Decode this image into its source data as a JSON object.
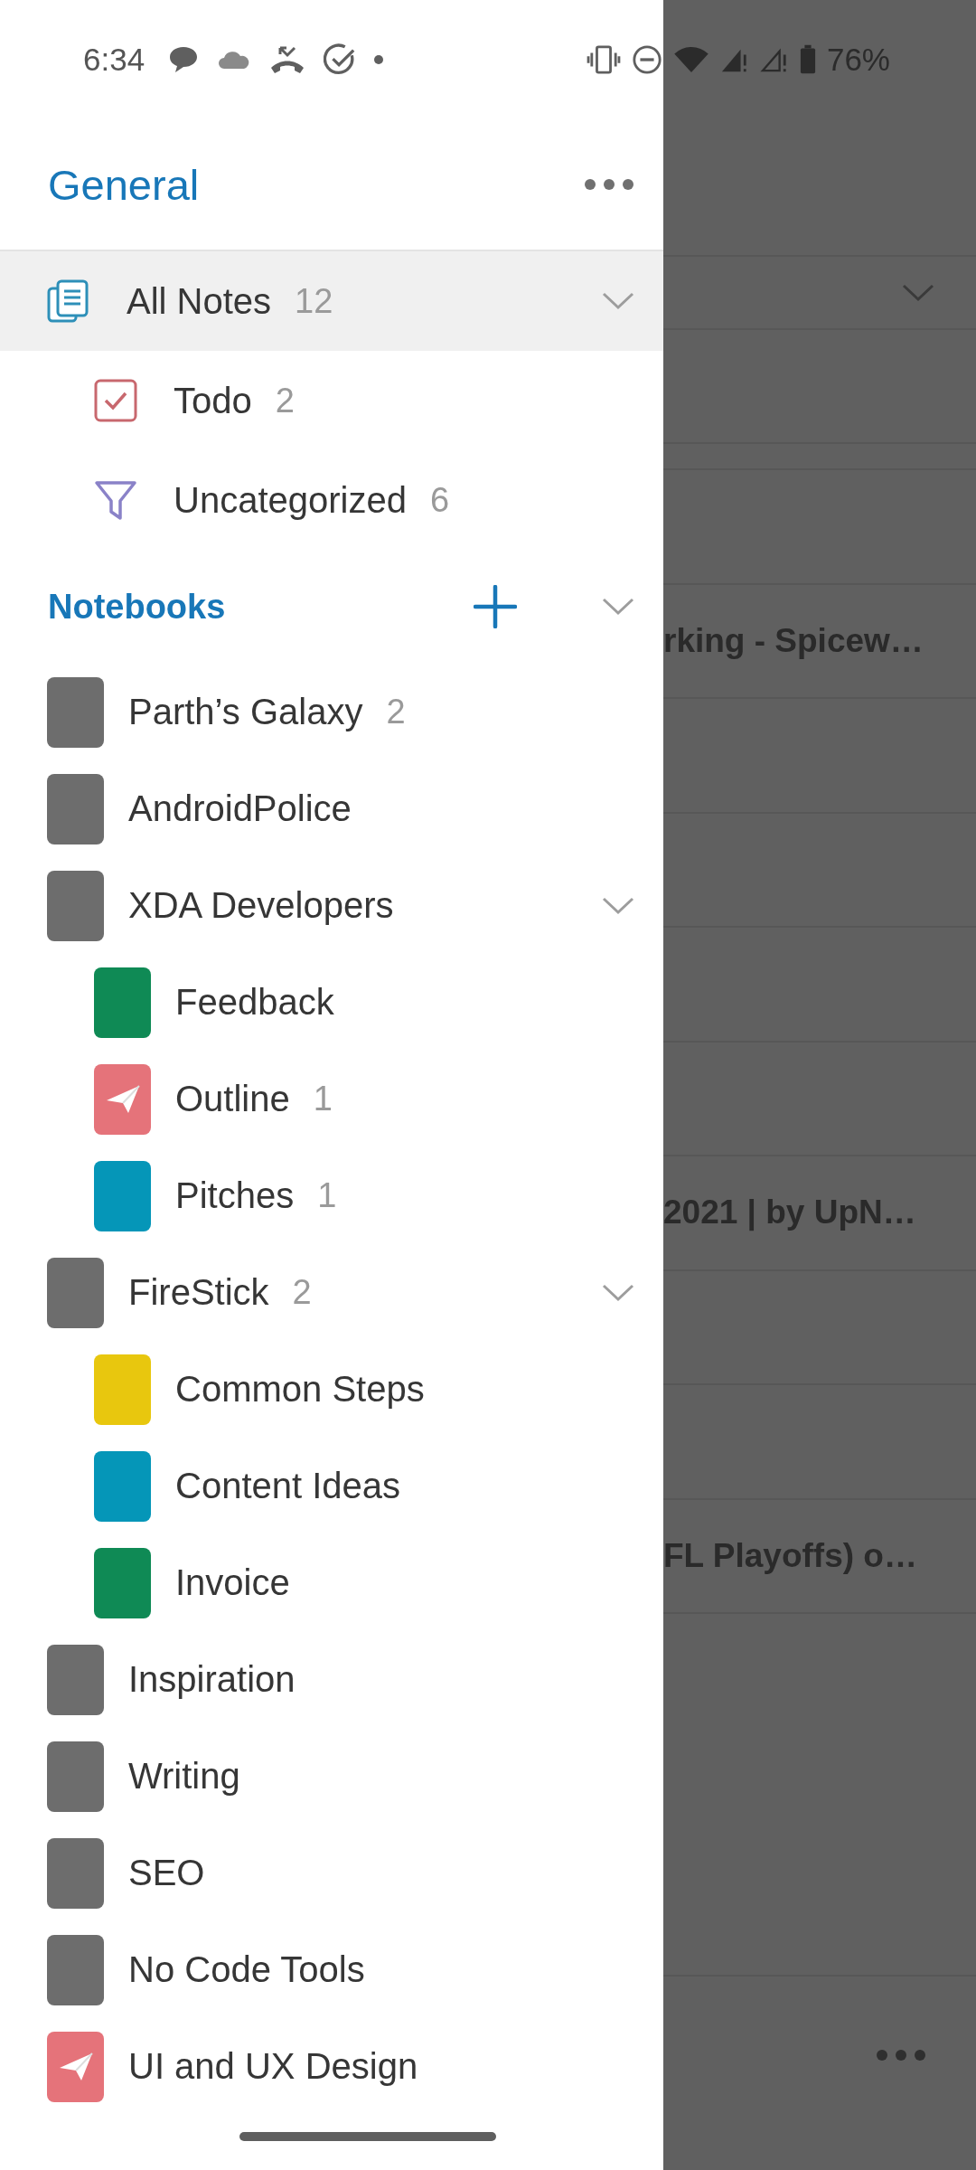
{
  "status_bar": {
    "time": "6:34",
    "battery": "76%"
  },
  "drawer": {
    "title": "General",
    "library": [
      {
        "kind": "all",
        "label": "All Notes",
        "count": "12",
        "selected": true
      },
      {
        "kind": "todo",
        "label": "Todo",
        "count": "2",
        "selected": false
      },
      {
        "kind": "uncategorized",
        "label": "Uncategorized",
        "count": "6",
        "selected": false
      }
    ],
    "notebooks_title": "Notebooks",
    "notebooks": [
      {
        "kind": "photo",
        "label": "Parth’s Galaxy",
        "count": "2",
        "selected": false
      },
      {
        "kind": "photo",
        "label": "AndroidPolice",
        "selected": false
      },
      {
        "kind": "photo",
        "label": "XDA Developers",
        "selected": false,
        "expanded": true,
        "children": [
          {
            "kind": "tile",
            "label": "Feedback",
            "color": "#0f8a55",
            "selected": false
          },
          {
            "kind": "plane",
            "label": "Outline",
            "count": "1",
            "color": "#e5737a",
            "selected": false
          },
          {
            "kind": "tile",
            "label": "Pitches",
            "count": "1",
            "color": "#0596b8",
            "selected": false
          }
        ]
      },
      {
        "kind": "photo",
        "label": "FireStick",
        "count": "2",
        "selected": false,
        "expanded": true,
        "children": [
          {
            "kind": "tile",
            "label": "Common Steps",
            "color": "#e8c70e",
            "selected": false
          },
          {
            "kind": "tile",
            "label": "Content Ideas",
            "color": "#0596b8",
            "selected": false
          },
          {
            "kind": "tile",
            "label": "Invoice",
            "color": "#0f8a55",
            "selected": false
          }
        ]
      },
      {
        "kind": "photo",
        "label": "Inspiration",
        "selected": false
      },
      {
        "kind": "photo",
        "label": "Writing",
        "selected": false
      },
      {
        "kind": "photo",
        "label": "SEO",
        "selected": false
      },
      {
        "kind": "photo",
        "label": "No Code Tools",
        "selected": false
      },
      {
        "kind": "plane",
        "label": "UI and UX Design",
        "color": "#e5737a",
        "selected": false
      }
    ]
  },
  "background_list": {
    "rows": [
      {},
      {
        "title": "rking - Spicew…"
      },
      {},
      {},
      {},
      {},
      {
        "title": "2021 | by UpN…"
      },
      {},
      {},
      {
        "title": "FL Playoffs) o…"
      }
    ]
  }
}
